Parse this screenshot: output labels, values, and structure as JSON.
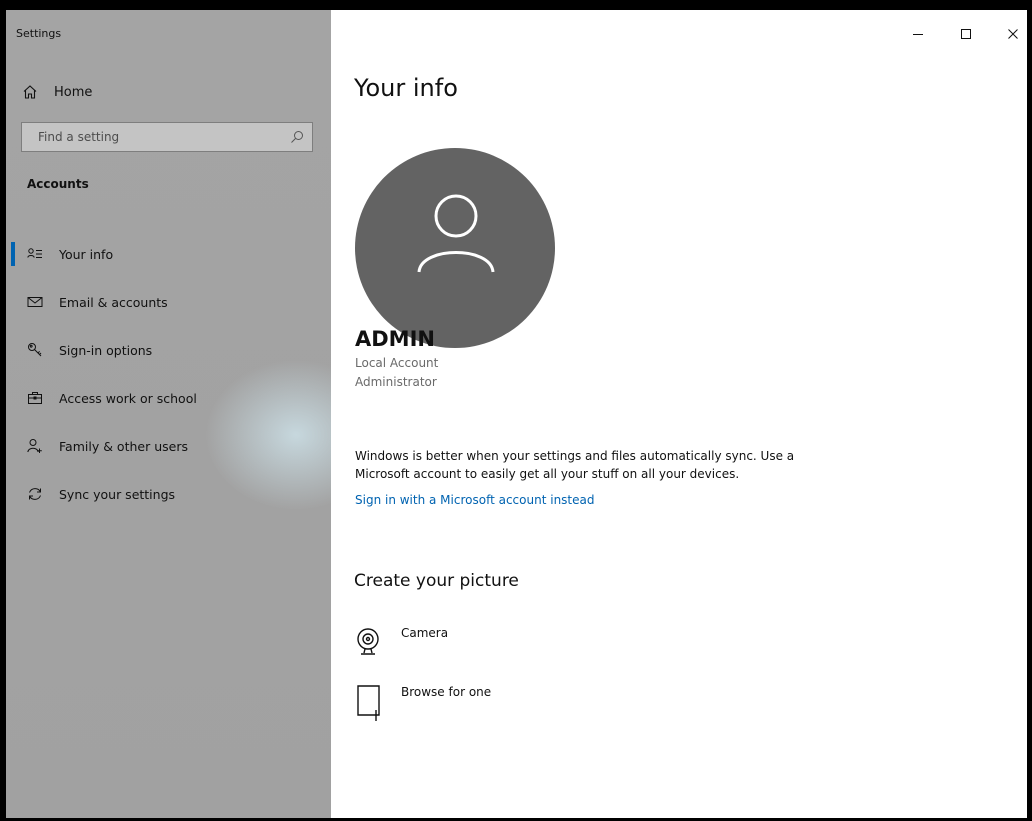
{
  "window": {
    "app_title": "Settings",
    "controls": [
      "minimize-icon",
      "maximize-icon",
      "close-icon"
    ]
  },
  "sidebar": {
    "home_label": "Home",
    "search_placeholder": "Find a setting",
    "section_title": "Accounts",
    "items": [
      {
        "label": "Your info",
        "icon": "your-info-icon",
        "active": true
      },
      {
        "label": "Email & accounts",
        "icon": "email-icon",
        "active": false
      },
      {
        "label": "Sign-in options",
        "icon": "key-icon",
        "active": false
      },
      {
        "label": "Access work or school",
        "icon": "briefcase-icon",
        "active": false
      },
      {
        "label": "Family & other users",
        "icon": "add-person-icon",
        "active": false
      },
      {
        "label": "Sync your settings",
        "icon": "sync-icon",
        "active": false
      }
    ]
  },
  "main": {
    "title": "Your info",
    "user": {
      "name": "ADMIN",
      "account_type": "Local Account",
      "role": "Administrator"
    },
    "sync_message": "Windows is better when your settings and files automatically sync. Use a Microsoft account to easily get all your stuff on all your devices.",
    "signin_link": "Sign in with a Microsoft account instead",
    "picture_section": {
      "title": "Create your picture",
      "options": [
        {
          "label": "Camera",
          "icon": "camera-icon"
        },
        {
          "label": "Browse for one",
          "icon": "browse-icon"
        }
      ]
    }
  },
  "colors": {
    "accent": "#0063b1",
    "sidebar_bg": "#a3a3a3",
    "avatar_bg": "#636363"
  }
}
